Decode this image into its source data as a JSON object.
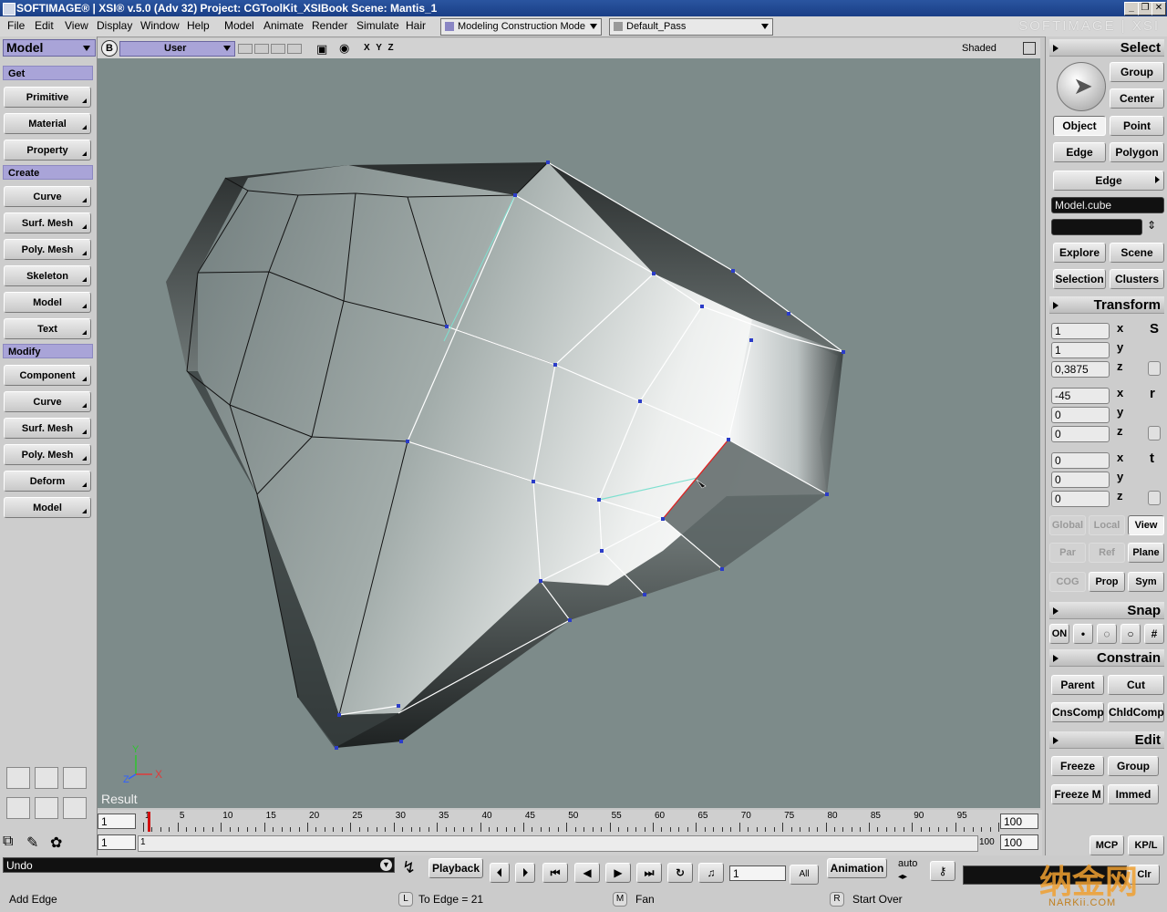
{
  "window": {
    "title": "SOFTIMAGE® | XSI® v.5.0 (Adv 32) Project: CGToolKit_XSIBook    Scene: Mantis_1",
    "brand": "SOFTIMAGE | XSI"
  },
  "menu": {
    "items": [
      "File",
      "Edit",
      "View",
      "Display",
      "Window",
      "Help"
    ],
    "modules": [
      "Model",
      "Animate",
      "Render",
      "Simulate",
      "Hair"
    ],
    "construction_mode": "Modeling Construction Mode",
    "pass": "Default_Pass"
  },
  "left_panel": {
    "mode": "Model",
    "sections": [
      {
        "title": "Get",
        "buttons": [
          "Primitive",
          "Material",
          "Property"
        ]
      },
      {
        "title": "Create",
        "buttons": [
          "Curve",
          "Surf. Mesh",
          "Poly. Mesh",
          "Skeleton",
          "Model",
          "Text"
        ]
      },
      {
        "title": "Modify",
        "buttons": [
          "Component",
          "Curve",
          "Surf. Mesh",
          "Poly. Mesh",
          "Deform",
          "Model"
        ]
      }
    ]
  },
  "viewport": {
    "letter": "B",
    "camera": "User",
    "axes_label": "X Y Z",
    "display_mode": "Shaded",
    "result_label": "Result",
    "gizmo": {
      "y": "Y",
      "x": "X",
      "z": "Z"
    }
  },
  "right_panel": {
    "select": {
      "title": "Select",
      "group": "Group",
      "center": "Center",
      "object": "Object",
      "point": "Point",
      "edge": "Edge",
      "polygon": "Polygon",
      "edge_filter": "Edge",
      "selection_name": "Model.cube",
      "explore": "Explore",
      "scene": "Scene",
      "selection": "Selection",
      "clusters": "Clusters"
    },
    "transform": {
      "title": "Transform",
      "scale": [
        "1",
        "1",
        "0,3875"
      ],
      "rotate": [
        "-45",
        "0",
        "0"
      ],
      "translate": [
        "0",
        "0",
        "0"
      ],
      "axes": [
        "x",
        "y",
        "z"
      ],
      "s_label": "S",
      "r_label": "r",
      "t_label": "t",
      "global": "Global",
      "local": "Local",
      "view": "View",
      "par": "Par",
      "ref": "Ref",
      "plane": "Plane",
      "cog": "COG",
      "prop": "Prop",
      "sym": "Sym"
    },
    "snap": {
      "title": "Snap",
      "on": "ON"
    },
    "constrain": {
      "title": "Constrain",
      "parent": "Parent",
      "cut": "Cut",
      "cnscomp": "CnsComp",
      "chldcomp": "ChldComp"
    },
    "edit": {
      "title": "Edit",
      "freeze": "Freeze",
      "group": "Group",
      "freeze_m": "Freeze M",
      "immed": "Immed"
    },
    "mcp": "MCP",
    "kpl": "KP/L"
  },
  "timeline": {
    "start": "1",
    "current": "1",
    "end": "100",
    "end2": "100",
    "ticks": [
      "1",
      "5",
      "10",
      "15",
      "20",
      "25",
      "30",
      "35",
      "40",
      "45",
      "50",
      "55",
      "60",
      "65",
      "70",
      "75",
      "80",
      "85",
      "90",
      "95"
    ],
    "lower_start": "1",
    "lower_end": "100"
  },
  "playback": {
    "undo": "Undo",
    "playback": "Playback",
    "frame": "1",
    "all": "All",
    "animation": "Animation",
    "auto": "auto",
    "clr": "Clr"
  },
  "status": {
    "tool": "Add Edge",
    "left_key": "L",
    "left_text": "To Edge = 21",
    "middle_key": "M",
    "middle_text": "Fan",
    "right_key": "R",
    "right_text": "Start Over"
  },
  "watermark": {
    "main": "纳金网",
    "sub": "NARKii.COM"
  },
  "colors": {
    "accent": "#a9a4d8",
    "viewport_bg": "#7d8b8a",
    "titlebar": "#1f4a94"
  }
}
